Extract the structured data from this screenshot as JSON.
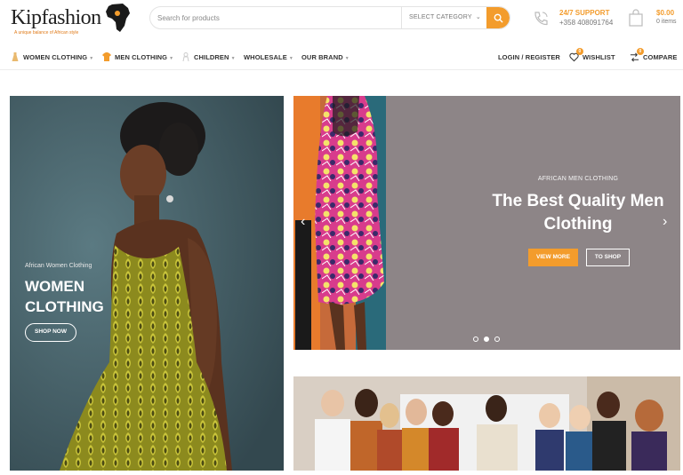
{
  "header": {
    "logo_text": "Kipfashion",
    "logo_tagline": "A unique balance of African style",
    "search": {
      "placeholder": "Search for products",
      "category_label": "SELECT CATEGORY"
    },
    "support": {
      "title": "24/7 SUPPORT",
      "phone": "+358 408091764"
    },
    "cart": {
      "amount": "$0.00",
      "items": "0 items"
    }
  },
  "nav": {
    "items": [
      {
        "label": "WOMEN CLOTHING"
      },
      {
        "label": "MEN CLOTHING"
      },
      {
        "label": "CHILDREN"
      },
      {
        "label": "WHOLESALE"
      },
      {
        "label": "OUR BRAND"
      }
    ],
    "login_label": "LOGIN / REGISTER",
    "wishlist_label": "WISHLIST",
    "wishlist_count": "0",
    "compare_label": "COMPARE",
    "compare_count": "0"
  },
  "hero_left": {
    "subtitle": "African Women Clothing",
    "title": "WOMEN CLOTHING",
    "button": "SHOP NOW"
  },
  "slider": {
    "subtitle": "AFRICAN MEN CLOTHING",
    "title": "The Best Quality Men Clothing",
    "button_primary": "VIEW MORE",
    "button_secondary": "TO SHOP",
    "active_slide": 2,
    "slide_count": 3
  },
  "colors": {
    "accent": "#f39c2c",
    "slider_bg": "#8d8587",
    "hero_bg": "#42606b"
  }
}
